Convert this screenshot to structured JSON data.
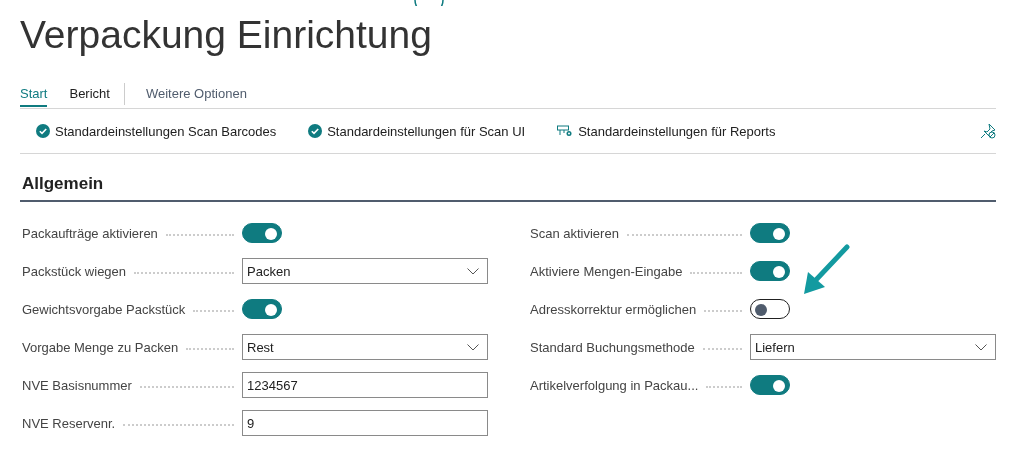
{
  "title": "Verpackung Einrichtung",
  "tabs": [
    {
      "label": "Start",
      "selected": true
    },
    {
      "label": "Bericht",
      "selected": false
    }
  ],
  "more_options": "Weitere Optionen",
  "actions": [
    {
      "label": "Standardeinstellungen Scan Barcodes",
      "kind": "check"
    },
    {
      "label": "Standardeinstellungen für Scan UI",
      "kind": "check"
    },
    {
      "label": "Standardeinstellungen für Reports",
      "kind": "setup"
    }
  ],
  "section": {
    "title": "Allgemein",
    "columns": [
      [
        {
          "label": "Packaufträge aktivieren",
          "kind": "toggle",
          "on": true
        },
        {
          "label": "Packstück wiegen",
          "kind": "select",
          "value": "Packen"
        },
        {
          "label": "Gewichtsvorgabe Packstück",
          "kind": "toggle",
          "on": true
        },
        {
          "label": "Vorgabe Menge zu Packen",
          "kind": "select",
          "value": "Rest"
        },
        {
          "label": "NVE Basisnummer",
          "kind": "text",
          "value": "1234567"
        },
        {
          "label": "NVE Reservenr.",
          "kind": "text",
          "value": "9"
        }
      ],
      [
        {
          "label": "Scan aktivieren",
          "kind": "toggle",
          "on": true
        },
        {
          "label": "Aktiviere Mengen-Eingabe",
          "kind": "toggle",
          "on": true
        },
        {
          "label": "Adresskorrektur ermöglichen",
          "kind": "toggle",
          "on": false
        },
        {
          "label": "Standard Buchungsmethode",
          "kind": "select",
          "value": "Liefern"
        },
        {
          "label": "Artikelverfolgung in Packau...",
          "kind": "toggle",
          "on": true
        }
      ]
    ]
  }
}
